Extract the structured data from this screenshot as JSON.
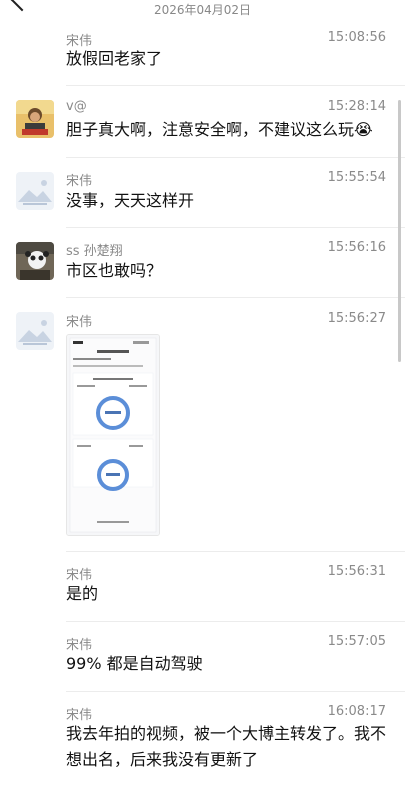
{
  "header": {
    "date": "2026年04月02日"
  },
  "messages": [
    {
      "sender": "宋伟",
      "time": "15:08:56",
      "text": "放假回老家了"
    },
    {
      "sender": "v@",
      "time": "15:28:14",
      "text": "胆子真大啊，注意安全啊，不建议这么玩😭"
    },
    {
      "sender": "宋伟",
      "time": "15:55:54",
      "text": "没事，天天这样开"
    },
    {
      "sender": "ss 孙楚翔",
      "time": "15:56:16",
      "text": "市区也敢吗？"
    },
    {
      "sender": "宋伟",
      "time": "15:56:27",
      "text": ""
    },
    {
      "sender": "宋伟",
      "time": "15:56:31",
      "text": "是的"
    },
    {
      "sender": "宋伟",
      "time": "15:57:05",
      "text": "99% 都是自动驾驶"
    },
    {
      "sender": "宋伟",
      "time": "16:08:17",
      "text": "我去年拍的视频，被一个大博主转发了。我不想出名，后来我没有更新了"
    }
  ],
  "colors": {
    "avatar_red": "#c0392b",
    "circle_blue": "#5b8ed8"
  }
}
